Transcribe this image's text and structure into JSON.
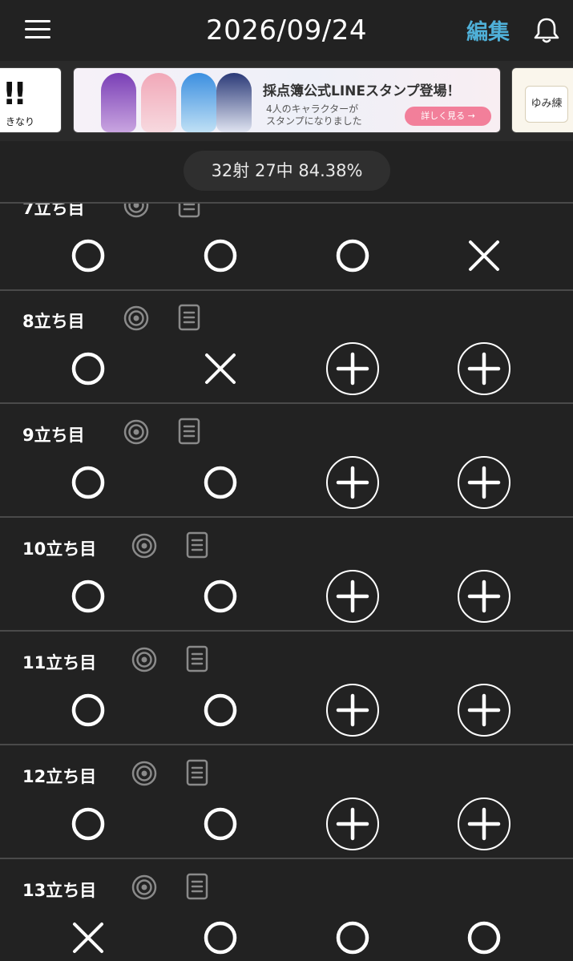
{
  "header": {
    "date": "2026/09/24",
    "edit_label": "編集",
    "menu_icon": "hamburger-menu-icon",
    "bell_icon": "bell-icon"
  },
  "banners": {
    "left": {
      "text": "!!",
      "small": "きなり"
    },
    "main": {
      "title": "採点簿公式LINEスタンプ登場！",
      "subtitle_line1": "4人のキャラクターが",
      "subtitle_line2": "スタンプになりました",
      "button": "詳しく見る →"
    },
    "right": {
      "logo_text": "ゆみ練"
    }
  },
  "stats": {
    "summary": "32射 27中 84.38%"
  },
  "colors": {
    "accent": "#4fb0d8",
    "background": "#222222",
    "separator": "#4a4a4a",
    "icon_gray": "#8a8a8a"
  },
  "rounds": [
    {
      "label": "7立ち目",
      "shots": [
        "hit",
        "hit",
        "hit",
        "miss"
      ]
    },
    {
      "label": "8立ち目",
      "shots": [
        "hit",
        "miss",
        "add",
        "add"
      ]
    },
    {
      "label": "9立ち目",
      "shots": [
        "hit",
        "hit",
        "add",
        "add"
      ]
    },
    {
      "label": "10立ち目",
      "shots": [
        "hit",
        "hit",
        "add",
        "add"
      ]
    },
    {
      "label": "11立ち目",
      "shots": [
        "hit",
        "hit",
        "add",
        "add"
      ]
    },
    {
      "label": "12立ち目",
      "shots": [
        "hit",
        "hit",
        "add",
        "add"
      ]
    },
    {
      "label": "13立ち目",
      "shots": [
        "miss",
        "hit",
        "hit",
        "hit"
      ]
    }
  ]
}
